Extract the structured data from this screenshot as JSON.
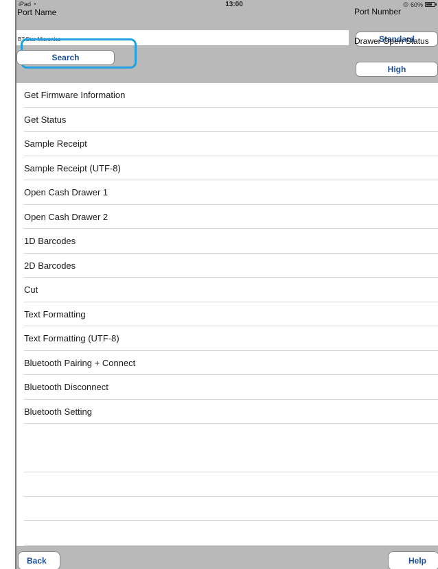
{
  "status_bar": {
    "device": "iPad",
    "time": "13:00",
    "battery": "60%"
  },
  "header": {
    "port_name_label": "Port Name",
    "port_name_value": "BT:Star Micronics",
    "search_label": "Search",
    "port_number_label": "Port Number",
    "port_number_value": "Standard",
    "drawer_status_label": "Drawer Open Status",
    "drawer_status_value": "High"
  },
  "menu_items": [
    "Get Firmware Information",
    "Get Status",
    "Sample Receipt",
    "Sample Receipt (UTF-8)",
    "Open Cash Drawer 1",
    "Open Cash Drawer 2",
    "1D Barcodes",
    "2D Barcodes",
    "Cut",
    "Text Formatting",
    "Text Formatting (UTF-8)",
    "Bluetooth Pairing + Connect",
    "Bluetooth Disconnect",
    "Bluetooth Setting"
  ],
  "footer": {
    "back_label": "Back",
    "help_label": "Help"
  },
  "colors": {
    "header_bg": "#b9b9b9",
    "button_text": "#1a4d9c",
    "highlight": "#1da1e0"
  }
}
